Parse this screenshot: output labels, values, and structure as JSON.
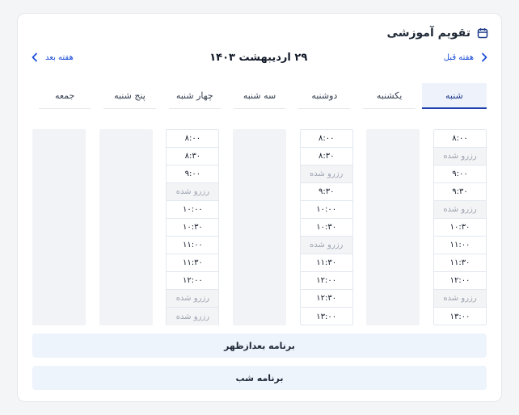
{
  "header": {
    "title": "تقویم آموزشی",
    "icon": "calendar-icon"
  },
  "nav": {
    "prev_label": "هفته قبل",
    "next_label": "هفته بعد",
    "current_date": "۲۹ اردیبهشت ۱۴۰۳"
  },
  "days": [
    {
      "label": "شنبه",
      "active": true,
      "slots": [
        {
          "text": "۸:۰۰",
          "booked": false
        },
        {
          "text": "رزرو شده",
          "booked": true
        },
        {
          "text": "۹:۰۰",
          "booked": false
        },
        {
          "text": "۹:۳۰",
          "booked": false
        },
        {
          "text": "رزرو شده",
          "booked": true
        },
        {
          "text": "۱۰:۳۰",
          "booked": false
        },
        {
          "text": "۱۱:۰۰",
          "booked": false
        },
        {
          "text": "۱۱:۳۰",
          "booked": false
        },
        {
          "text": "۱۲:۰۰",
          "booked": false
        },
        {
          "text": "رزرو شده",
          "booked": true
        },
        {
          "text": "۱۳:۰۰",
          "booked": false
        }
      ]
    },
    {
      "label": "یکشنبه",
      "active": false,
      "slots": []
    },
    {
      "label": "دوشنبه",
      "active": false,
      "slots": [
        {
          "text": "۸:۰۰",
          "booked": false
        },
        {
          "text": "۸:۳۰",
          "booked": false
        },
        {
          "text": "رزرو شده",
          "booked": true
        },
        {
          "text": "۹:۳۰",
          "booked": false
        },
        {
          "text": "۱۰:۰۰",
          "booked": false
        },
        {
          "text": "۱۰:۳۰",
          "booked": false
        },
        {
          "text": "رزرو شده",
          "booked": true
        },
        {
          "text": "۱۱:۳۰",
          "booked": false
        },
        {
          "text": "۱۲:۰۰",
          "booked": false
        },
        {
          "text": "۱۲:۳۰",
          "booked": false
        },
        {
          "text": "۱۳:۰۰",
          "booked": false
        }
      ]
    },
    {
      "label": "سه شنبه",
      "active": false,
      "slots": []
    },
    {
      "label": "چهار شنبه",
      "active": false,
      "slots": [
        {
          "text": "۸:۰۰",
          "booked": false
        },
        {
          "text": "۸:۳۰",
          "booked": false
        },
        {
          "text": "۹:۰۰",
          "booked": false
        },
        {
          "text": "رزرو شده",
          "booked": true
        },
        {
          "text": "۱۰:۰۰",
          "booked": false
        },
        {
          "text": "۱۰:۳۰",
          "booked": false
        },
        {
          "text": "۱۱:۰۰",
          "booked": false
        },
        {
          "text": "۱۱:۳۰",
          "booked": false
        },
        {
          "text": "۱۲:۰۰",
          "booked": false
        },
        {
          "text": "رزرو شده",
          "booked": true
        },
        {
          "text": "رزرو شده",
          "booked": true
        }
      ]
    },
    {
      "label": "پنج شنبه",
      "active": false,
      "slots": []
    },
    {
      "label": "جمعه",
      "active": false,
      "slots": []
    }
  ],
  "programs": {
    "afternoon": "برنامه بعدازظهر",
    "night": "برنامه شب"
  },
  "colors": {
    "accent": "#1e40af",
    "active_tab_bg": "#eef3fb",
    "booked_bg": "#f3f4f6",
    "program_bg": "#eef4fc"
  }
}
